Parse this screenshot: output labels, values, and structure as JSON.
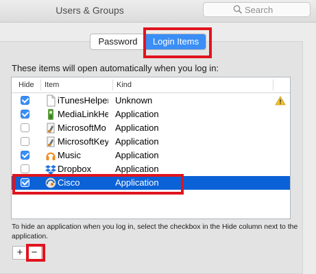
{
  "window": {
    "title": "Users & Groups"
  },
  "search": {
    "placeholder": "Search"
  },
  "tabs": [
    {
      "label": "Password",
      "selected": false
    },
    {
      "label": "Login Items",
      "selected": true
    }
  ],
  "description": "These items will open automatically when you log in:",
  "table": {
    "columns": {
      "hide": "Hide",
      "item": "Item",
      "kind": "Kind"
    },
    "rows": [
      {
        "name": "iTunesHelper",
        "kind": "Unknown",
        "hide": true,
        "icon": "document-icon",
        "warning": true,
        "selected": false
      },
      {
        "name": "MediaLinkHelper",
        "kind": "Application",
        "hide": true,
        "icon": "medialink-icon",
        "warning": false,
        "selected": false
      },
      {
        "name": "MicrosoftMo",
        "kind": "Application",
        "hide": false,
        "icon": "microsoft-app-icon",
        "warning": false,
        "selected": false
      },
      {
        "name": "MicrosoftKey",
        "kind": "Application",
        "hide": false,
        "icon": "microsoft-app-icon",
        "warning": false,
        "selected": false
      },
      {
        "name": "Music",
        "kind": "Application",
        "hide": true,
        "icon": "headphones-icon",
        "warning": false,
        "selected": false
      },
      {
        "name": "Dropbox",
        "kind": "Application",
        "hide": false,
        "icon": "dropbox-icon",
        "warning": false,
        "selected": false
      },
      {
        "name": "Cisco",
        "kind": "Application",
        "hide": true,
        "icon": "cisco-icon",
        "warning": false,
        "selected": true
      }
    ]
  },
  "hint": "To hide an application when you log in, select the checkbox in the Hide column next to the application.",
  "buttons": {
    "add": "+",
    "remove": "−"
  },
  "colors": {
    "accent": "#3b8ef5",
    "selection": "#0b62d7",
    "highlight": "#e0141e"
  }
}
